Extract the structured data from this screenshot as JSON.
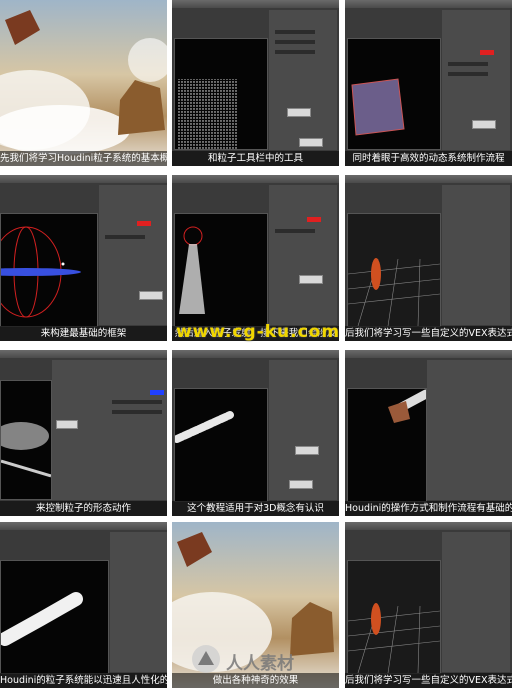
{
  "tiles": [
    {
      "caption": "先我们将学习Houdini粒子系统的基本概"
    },
    {
      "caption": "和粒子工具栏中的工具"
    },
    {
      "caption": "同时着眼于高效的动态系统制作流程"
    },
    {
      "caption": "来构建最基础的框架"
    },
    {
      "caption": "然后进入粒子发射，接下来我们会涉及"
    },
    {
      "caption": "后我们将学习写一些自定义的VEX表达式"
    },
    {
      "caption": "来控制粒子的形态动作"
    },
    {
      "caption": "这个教程适用于对3D概念有认识"
    },
    {
      "caption": "Houdini的操作方式和制作流程有基础的"
    },
    {
      "caption": "Houdini的粒子系统能以迅速且人性化的方"
    },
    {
      "caption": "做出各种神奇的效果"
    },
    {
      "caption": "后我们将学习写一些自定义的VEX表达式"
    }
  ],
  "watermark": "www.cg-ku.com",
  "logo_text": "人人素材",
  "colors": {
    "accent_red": "#e02020",
    "accent_blue": "#2040ff",
    "watermark": "#f0d600"
  }
}
